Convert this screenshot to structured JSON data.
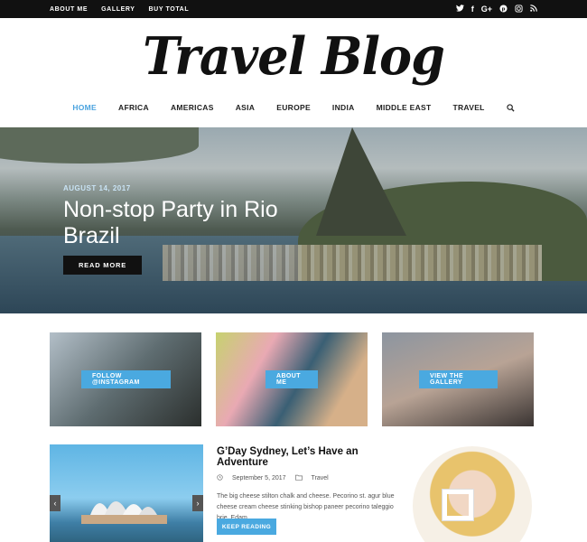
{
  "topbar": {
    "links": [
      "About Me",
      "Gallery",
      "Buy Total"
    ]
  },
  "social": [
    "twitter-icon",
    "facebook-icon",
    "google-plus-icon",
    "pinterest-icon",
    "instagram-icon",
    "rss-icon"
  ],
  "logo": "Travel Blog",
  "nav": [
    "HOME",
    "AFRICA",
    "AMERICAS",
    "ASIA",
    "EUROPE",
    "INDIA",
    "MIDDLE EAST",
    "TRAVEL"
  ],
  "accent": "#4aa9e0",
  "hero": {
    "date": "AUGUST 14, 2017",
    "title": "Non-stop Party in Rio Brazil",
    "button": "READ MORE"
  },
  "tiles": [
    {
      "label": "FOLLOW @INSTAGRAM"
    },
    {
      "label": "ABOUT ME"
    },
    {
      "label": "VIEW THE GALLERY"
    }
  ],
  "post": {
    "title": "G’Day Sydney, Let’s Have an Adventure",
    "date": "September 5, 2017",
    "category": "Travel",
    "excerpt": "The big cheese stilton chalk and cheese. Pecorino st. agur blue cheese cream cheese stinking bishop paneer pecorino taleggio brie. Edam...",
    "button": "KEEP READING"
  }
}
